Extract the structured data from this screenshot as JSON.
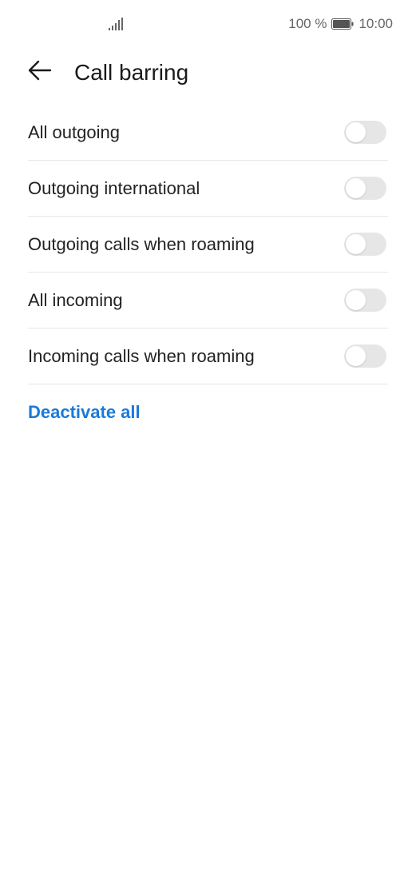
{
  "status_bar": {
    "signal_icon": "signal-bars-icon",
    "battery_percent": "100 %",
    "battery_icon": "battery-full-icon",
    "time": "10:00"
  },
  "header": {
    "back_icon": "arrow-left-icon",
    "title": "Call barring"
  },
  "settings": [
    {
      "label": "All outgoing",
      "enabled": false
    },
    {
      "label": "Outgoing international",
      "enabled": false
    },
    {
      "label": "Outgoing calls when roaming",
      "enabled": false
    },
    {
      "label": "All incoming",
      "enabled": false
    },
    {
      "label": "Incoming calls when roaming",
      "enabled": false
    }
  ],
  "actions": {
    "deactivate_all": "Deactivate all"
  },
  "colors": {
    "accent": "#1a7ad9",
    "toggle_off": "#e6e6e6",
    "divider": "#e6e6e6"
  }
}
